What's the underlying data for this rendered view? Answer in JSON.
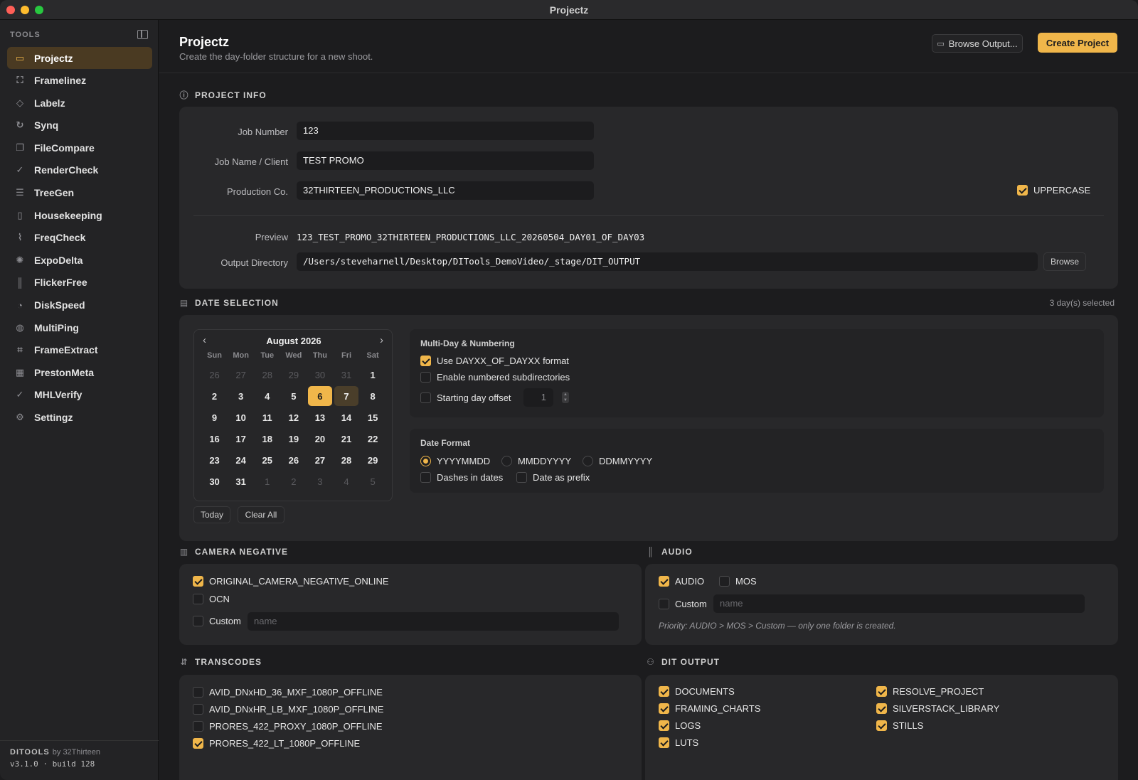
{
  "window": {
    "title": "Projectz"
  },
  "sidebar": {
    "heading": "TOOLS",
    "items": [
      {
        "label": "Projectz",
        "icon": "folder-icon",
        "glyph": "▭"
      },
      {
        "label": "Framelinez",
        "icon": "frame-icon",
        "glyph": "⛶"
      },
      {
        "label": "Labelz",
        "icon": "tag-icon",
        "glyph": "◇"
      },
      {
        "label": "Synq",
        "icon": "sync-icon",
        "glyph": "↻"
      },
      {
        "label": "FileCompare",
        "icon": "files-icon",
        "glyph": "❐"
      },
      {
        "label": "RenderCheck",
        "icon": "check-badge-icon",
        "glyph": "✓"
      },
      {
        "label": "TreeGen",
        "icon": "tree-list-icon",
        "glyph": "☰"
      },
      {
        "label": "Housekeeping",
        "icon": "trash-icon",
        "glyph": "▯"
      },
      {
        "label": "FreqCheck",
        "icon": "antenna-icon",
        "glyph": "⌇"
      },
      {
        "label": "ExpoDelta",
        "icon": "aperture-icon",
        "glyph": "✺"
      },
      {
        "label": "FlickerFree",
        "icon": "waveform-icon",
        "glyph": "║"
      },
      {
        "label": "DiskSpeed",
        "icon": "gauge-icon",
        "glyph": "◔"
      },
      {
        "label": "MultiPing",
        "icon": "globe-icon",
        "glyph": "◍"
      },
      {
        "label": "FrameExtract",
        "icon": "crop-icon",
        "glyph": "⌗"
      },
      {
        "label": "PrestonMeta",
        "icon": "table-icon",
        "glyph": "▦"
      },
      {
        "label": "MHLVerify",
        "icon": "verified-icon",
        "glyph": "✓"
      },
      {
        "label": "Settingz",
        "icon": "gear-icon",
        "glyph": "⚙"
      }
    ],
    "brand": "DITOOLS",
    "brand_by": "by 32Thirteen",
    "version": "v3.1.0 · build 128"
  },
  "header": {
    "title": "Projectz",
    "subtitle": "Create the day-folder structure for a new shoot.",
    "browse_output": "Browse Output...",
    "create_project": "Create Project"
  },
  "project_info": {
    "section": "PROJECT INFO",
    "job_number_label": "Job Number",
    "job_number": "123",
    "job_name_label": "Job Name / Client",
    "job_name": "TEST PROMO",
    "production_label": "Production Co.",
    "production": "32THIRTEEN_PRODUCTIONS_LLC",
    "uppercase_label": "UPPERCASE",
    "preview_label": "Preview",
    "preview": "123_TEST_PROMO_32THIRTEEN_PRODUCTIONS_LLC_20260504_DAY01_OF_DAY03",
    "output_label": "Output Directory",
    "output_dir": "/Users/steveharnell/Desktop/DITools_DemoVideo/_stage/DIT_OUTPUT",
    "browse": "Browse"
  },
  "date_selection": {
    "section": "DATE SELECTION",
    "selected_count": "3 day(s) selected",
    "month": "August 2026",
    "weekdays": [
      "Sun",
      "Mon",
      "Tue",
      "Wed",
      "Thu",
      "Fri",
      "Sat"
    ],
    "weeks": [
      [
        [
          "26",
          1
        ],
        [
          "27",
          1
        ],
        [
          "28",
          1
        ],
        [
          "29",
          1
        ],
        [
          "30",
          1
        ],
        [
          "31",
          1
        ],
        [
          "1",
          0
        ]
      ],
      [
        [
          "2",
          0
        ],
        [
          "3",
          0
        ],
        [
          "4",
          0
        ],
        [
          "5",
          0
        ],
        [
          "6",
          2
        ],
        [
          "7",
          3
        ],
        [
          "8",
          0
        ]
      ],
      [
        [
          "9",
          0
        ],
        [
          "10",
          0
        ],
        [
          "11",
          0
        ],
        [
          "12",
          0
        ],
        [
          "13",
          0
        ],
        [
          "14",
          0
        ],
        [
          "15",
          0
        ]
      ],
      [
        [
          "16",
          0
        ],
        [
          "17",
          0
        ],
        [
          "18",
          0
        ],
        [
          "19",
          0
        ],
        [
          "20",
          0
        ],
        [
          "21",
          0
        ],
        [
          "22",
          0
        ]
      ],
      [
        [
          "23",
          0
        ],
        [
          "24",
          0
        ],
        [
          "25",
          0
        ],
        [
          "26",
          0
        ],
        [
          "27",
          0
        ],
        [
          "28",
          0
        ],
        [
          "29",
          0
        ]
      ],
      [
        [
          "30",
          0
        ],
        [
          "31",
          0
        ],
        [
          "1",
          1
        ],
        [
          "2",
          1
        ],
        [
          "3",
          1
        ],
        [
          "4",
          1
        ],
        [
          "5",
          1
        ]
      ]
    ],
    "today": "Today",
    "clear_all": "Clear All",
    "multi_day_title": "Multi-Day & Numbering",
    "use_dayxx": "Use DAYXX_OF_DAYXX format",
    "numbered_subdirs": "Enable numbered subdirectories",
    "start_offset": "Starting day offset",
    "offset_value": "1",
    "date_format_title": "Date Format",
    "fmt1": "YYYYMMDD",
    "fmt2": "MMDDYYYY",
    "fmt3": "DDMMYYYY",
    "dashes": "Dashes in dates",
    "prefix": "Date as prefix"
  },
  "camera_negative": {
    "section": "CAMERA NEGATIVE",
    "opt1": "ORIGINAL_CAMERA_NEGATIVE_ONLINE",
    "opt2": "OCN",
    "custom": "Custom",
    "placeholder": "name"
  },
  "audio": {
    "section": "AUDIO",
    "opt1": "AUDIO",
    "opt2": "MOS",
    "custom": "Custom",
    "placeholder": "name",
    "note": "Priority: AUDIO > MOS > Custom — only one folder is created."
  },
  "transcodes": {
    "section": "TRANSCODES",
    "items": [
      {
        "label": "AVID_DNxHD_36_MXF_1080P_OFFLINE",
        "checked": false
      },
      {
        "label": "AVID_DNxHR_LB_MXF_1080P_OFFLINE",
        "checked": false
      },
      {
        "label": "PRORES_422_PROXY_1080P_OFFLINE",
        "checked": false
      },
      {
        "label": "PRORES_422_LT_1080P_OFFLINE",
        "checked": true
      }
    ]
  },
  "dit_output": {
    "section": "DIT OUTPUT",
    "col1": [
      "DOCUMENTS",
      "FRAMING_CHARTS",
      "LOGS",
      "LUTS"
    ],
    "col2": [
      "RESOLVE_PROJECT",
      "SILVERSTACK_LIBRARY",
      "STILLS"
    ]
  },
  "colors": {
    "accent": "#f0b64a",
    "bg": "#1c1c1e",
    "panel": "#28282a"
  }
}
